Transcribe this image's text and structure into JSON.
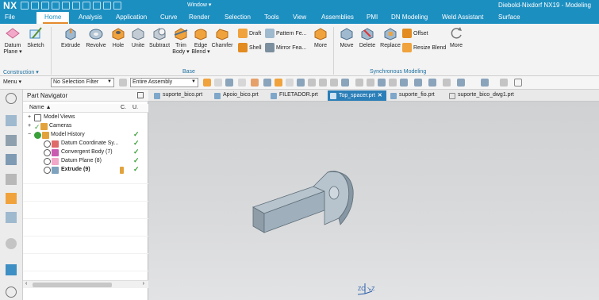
{
  "app": {
    "logo": "NX",
    "window_title": "Diebold-Nixdorf NX19 - Modeling",
    "window_menu": "Window ▾"
  },
  "menu_tabs": [
    "File",
    "Home",
    "Analysis",
    "Application",
    "Curve",
    "Render",
    "Selection",
    "Tools",
    "View",
    "Assemblies",
    "PMI",
    "DN Modeling",
    "Weld Assistant",
    "Surface"
  ],
  "active_tab": "Home",
  "ribbon": {
    "construction": {
      "datum_plane": "Datum Plane ▾",
      "sketch": "Sketch",
      "label": "Construction ▾"
    },
    "base": {
      "extrude": "Extrude",
      "revolve": "Revolve",
      "hole": "Hole",
      "unite": "Unite",
      "subtract": "Subtract",
      "trim_body": "Trim Body ▾",
      "edge_blend": "Edge Blend ▾",
      "chamfer": "Chamfer",
      "draft": "Draft",
      "shell": "Shell",
      "pattern_feature": "Pattern Fe...",
      "mirror_feature": "Mirror Fea...",
      "more": "More",
      "label": "Base"
    },
    "sync": {
      "move": "Move",
      "delete": "Delete",
      "replace": "Replace",
      "offset": "Offset",
      "resize_blend": "Resize Blend",
      "more": "More",
      "label": "Synchronous Modeling"
    }
  },
  "toolbar": {
    "menu": "Menu ▾",
    "selection_filter": "No Selection Filter",
    "assembly_scope": "Entire Assembly"
  },
  "navigator": {
    "title": "Part Navigator",
    "col_name": "Name ▲",
    "col_c": "C.",
    "col_u": "U.",
    "rows": [
      {
        "label": "Model Views",
        "checked": false
      },
      {
        "label": "Cameras",
        "checked": false
      },
      {
        "label": "Model History",
        "checked": true
      },
      {
        "label": "Datum Coordinate Sy...",
        "checked": true
      },
      {
        "label": "Convergent Body (7)",
        "checked": true
      },
      {
        "label": "Datum Plane (8)",
        "checked": true
      },
      {
        "label": "Extrude (9)",
        "checked": true
      }
    ]
  },
  "doc_tabs": [
    "suporte_bico.prt",
    "Apoio_bico.prt",
    "FILETADOR.prt",
    "Top_spacer.prt",
    "suporte_fio.prt",
    "suporte_bico_dwg1.prt"
  ],
  "active_doc": "Top_spacer.prt",
  "viewport": {
    "triad_label": "ZC ↘Z"
  }
}
